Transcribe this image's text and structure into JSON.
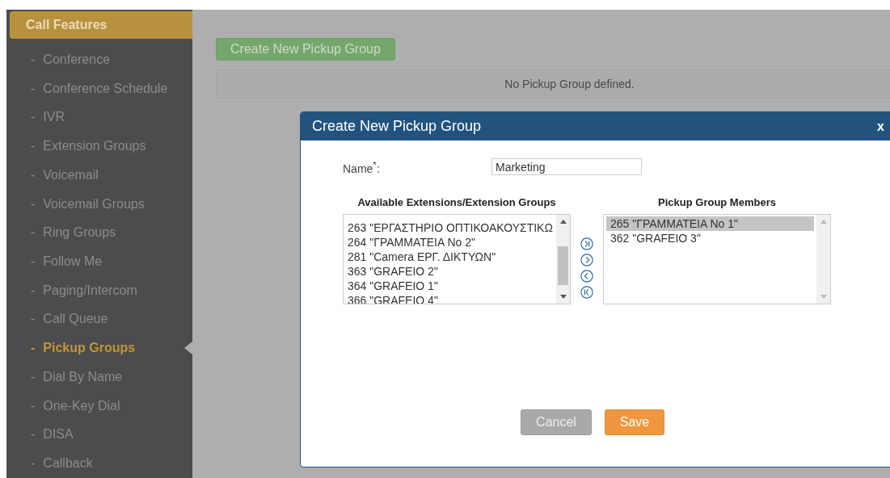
{
  "sidebar": {
    "header": "Call Features",
    "bullet": "-",
    "items": [
      {
        "label": "Conference",
        "selected": false
      },
      {
        "label": "Conference Schedule",
        "selected": false
      },
      {
        "label": "IVR",
        "selected": false
      },
      {
        "label": "Extension Groups",
        "selected": false
      },
      {
        "label": "Voicemail",
        "selected": false
      },
      {
        "label": "Voicemail Groups",
        "selected": false
      },
      {
        "label": "Ring Groups",
        "selected": false
      },
      {
        "label": "Follow Me",
        "selected": false
      },
      {
        "label": "Paging/Intercom",
        "selected": false
      },
      {
        "label": "Call Queue",
        "selected": false
      },
      {
        "label": "Pickup Groups",
        "selected": true
      },
      {
        "label": "Dial By Name",
        "selected": false
      },
      {
        "label": "One-Key Dial",
        "selected": false
      },
      {
        "label": "DISA",
        "selected": false
      },
      {
        "label": "Callback",
        "selected": false
      }
    ]
  },
  "main": {
    "create_button": "Create New Pickup Group",
    "empty_message": "No Pickup Group defined."
  },
  "dialog": {
    "title": "Create New Pickup Group",
    "close": "x",
    "name_label": "Name$^{*}$:",
    "name_value": "Marketing",
    "available": {
      "heading": "Available Extensions/Extension Groups",
      "items": [
        {
          "label": "263 \"ΕΡΓΑΣΤΗΡΙΟ ΟΠΤΙΚΟΑΚΟΥΣΤΙΚΩ",
          "selected": false
        },
        {
          "label": "264 \"ΓΡΑΜΜΑΤΕΙΑ No 2\"",
          "selected": false
        },
        {
          "label": "281 \"Camera ΕΡΓ. ΔΙΚΤΥΩΝ\"",
          "selected": false
        },
        {
          "label": "363 \"GRAFEIO 2\"",
          "selected": false
        },
        {
          "label": "364 \"GRAFEIO 1\"",
          "selected": false
        },
        {
          "label": "366 \"GRAFEIO 4\"",
          "selected": false
        }
      ]
    },
    "members": {
      "heading": "Pickup Group Members",
      "items": [
        {
          "label": "265 \"ΓΡΑΜΜΑΤΕΙΑ No 1\"",
          "selected": true
        },
        {
          "label": "362 \"GRAFEIO 3\"",
          "selected": false
        }
      ]
    },
    "buttons": [
      {
        "label": "Cancel",
        "kind": "secondary"
      },
      {
        "label": "Save",
        "kind": "primary"
      }
    ]
  }
}
